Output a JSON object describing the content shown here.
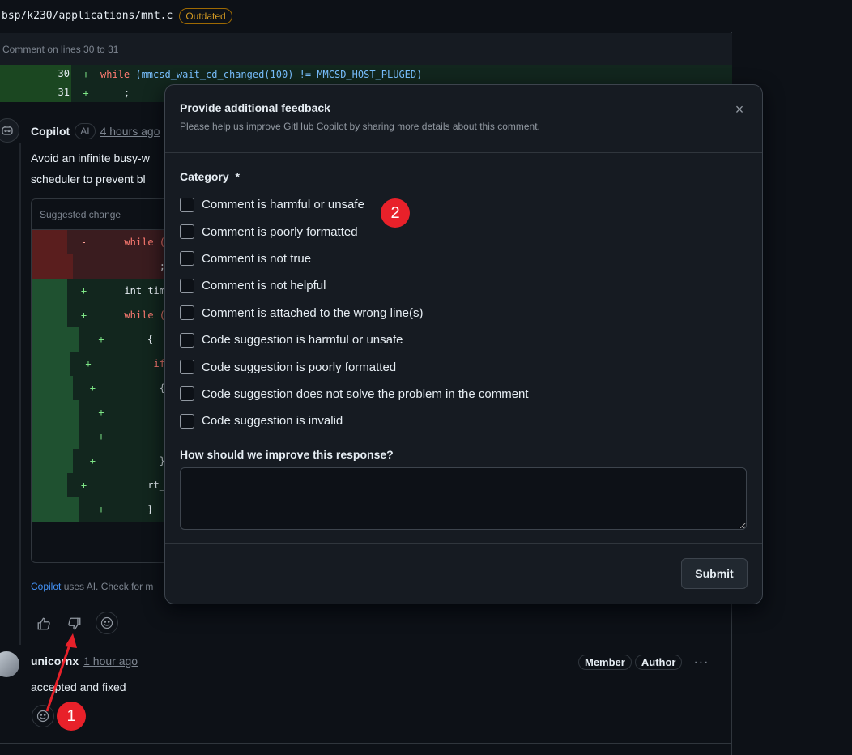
{
  "file": {
    "path": "bsp/k230/applications/mnt.c",
    "status_badge": "Outdated",
    "comment_lines": "Comment on lines 30 to 31"
  },
  "diff": [
    {
      "num": "30",
      "sign": "+",
      "code_kw": "while",
      "code_rest": " (mmcsd_wait_cd_changed(100) != MMCSD_HOST_PLUGED)"
    },
    {
      "num": "31",
      "sign": "+",
      "code_kw": "",
      "code_rest": "    ;"
    }
  ],
  "copilot_comment": {
    "author": "Copilot",
    "ai_badge": "AI",
    "time": "4 hours ago",
    "body_line1": "Avoid an infinite busy-w",
    "body_line2": "scheduler to prevent bl",
    "suggested_title": "Suggested change",
    "suggested_lines": [
      {
        "type": "del",
        "sign": "-",
        "text": "    while ("
      },
      {
        "type": "del",
        "sign": "-",
        "text": "        ;"
      },
      {
        "type": "add",
        "sign": "+",
        "text": "    int tim"
      },
      {
        "type": "add",
        "sign": "+",
        "text": "    while ("
      },
      {
        "type": "add",
        "sign": "+",
        "text": "    {"
      },
      {
        "type": "add",
        "sign": "+",
        "text": "        if"
      },
      {
        "type": "add",
        "sign": "+",
        "text": "        {"
      },
      {
        "type": "add",
        "sign": "+",
        "text": ""
      },
      {
        "type": "add",
        "sign": "+",
        "text": ""
      },
      {
        "type": "add",
        "sign": "+",
        "text": "        }"
      },
      {
        "type": "add",
        "sign": "+",
        "text": "        rt_"
      },
      {
        "type": "add",
        "sign": "+",
        "text": "    }"
      }
    ],
    "footer_link": "Copilot",
    "footer_text": " uses AI. Check for m"
  },
  "reply": {
    "author": "unicornx",
    "time": "1 hour ago",
    "badges": [
      "Member",
      "Author"
    ],
    "more": "···",
    "body": "accepted and fixed"
  },
  "modal": {
    "title": "Provide additional feedback",
    "subtitle": "Please help us improve GitHub Copilot by sharing more details about this comment.",
    "category_label": "Category  *",
    "options": [
      "Comment is harmful or unsafe",
      "Comment is poorly formatted",
      "Comment is not true",
      "Comment is not helpful",
      "Comment is attached to the wrong line(s)",
      "Code suggestion is harmful or unsafe",
      "Code suggestion is poorly formatted",
      "Code suggestion does not solve the problem in the comment",
      "Code suggestion is invalid"
    ],
    "improve_label": "How should we improve this response?",
    "improve_value": "",
    "submit_label": "Submit",
    "close_icon": "×"
  },
  "annotations": {
    "marker1": "1",
    "marker2": "2",
    "marker_color": "#e8212a"
  },
  "icons": {
    "copilot_avatar": "copilot-icon",
    "thumbs_up": "thumbs-up-icon",
    "thumbs_down": "thumbs-down-icon",
    "smiley": "smiley-icon",
    "close": "close-icon"
  }
}
